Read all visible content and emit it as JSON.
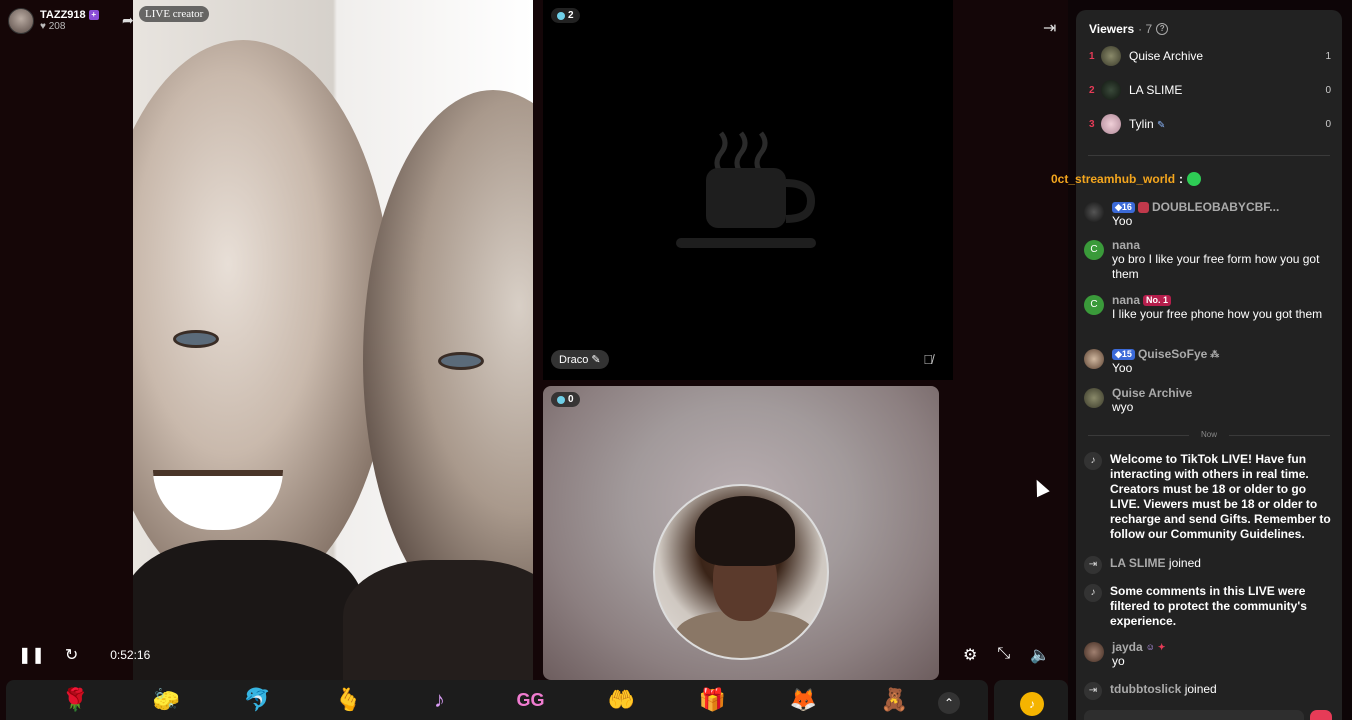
{
  "host": {
    "username": "TAZZ918",
    "badge": "+",
    "likes": "♥ 208",
    "tag": "LIVE creator"
  },
  "guests": {
    "top": {
      "viewer_count": "2",
      "name": "Draco",
      "name_icon": "✎"
    },
    "bottom": {
      "viewer_count": "0"
    }
  },
  "player": {
    "time": "0:52:16"
  },
  "gifts": [
    "🌹",
    "🧽",
    "🐬",
    "🫰",
    "♪",
    "GG",
    "🤲",
    "🎁",
    "🦊",
    "🧸"
  ],
  "viewers": {
    "title": "Viewers",
    "count": "· 7",
    "list": [
      {
        "rank": "1",
        "name": "Quise Archive",
        "value": "1"
      },
      {
        "rank": "2",
        "name": "LA SLIME",
        "value": "0"
      },
      {
        "rank": "3",
        "name": "Tylin",
        "value": "0"
      }
    ]
  },
  "floating_comment": {
    "user": "0ct_streamhub_world",
    "sep": ":"
  },
  "chat": [
    {
      "name": "DOUBLEOBABYCBF...",
      "level": "16",
      "text": "Yoo"
    },
    {
      "name": "nana",
      "text": "yo bro I like your free form how you got them"
    },
    {
      "name": "nana",
      "badge": "No. 1",
      "text": "I like your free phone how you got them"
    },
    {
      "name": "QuiseSoFye",
      "level": "15",
      "text": "Yoo"
    },
    {
      "name": "Quise Archive",
      "text": "wyo"
    }
  ],
  "now_label": "Now",
  "system": {
    "welcome": "Welcome to TikTok LIVE! Have fun interacting with others in real time. Creators must be 18 or older to go LIVE. Viewers must be 18 or older to recharge and send Gifts. Remember to follow our Community Guidelines.",
    "join1_user": "LA SLIME",
    "joined": "joined",
    "filtered": "Some comments in this LIVE were filtered to protect the community's experience.",
    "join2_user": "tdubbtoslick"
  },
  "jayda": {
    "name": "jayda",
    "text": "yo"
  },
  "colors": {
    "accent": "#e63b57",
    "level": "#3b6ad8",
    "gold": "#f4a61e"
  }
}
